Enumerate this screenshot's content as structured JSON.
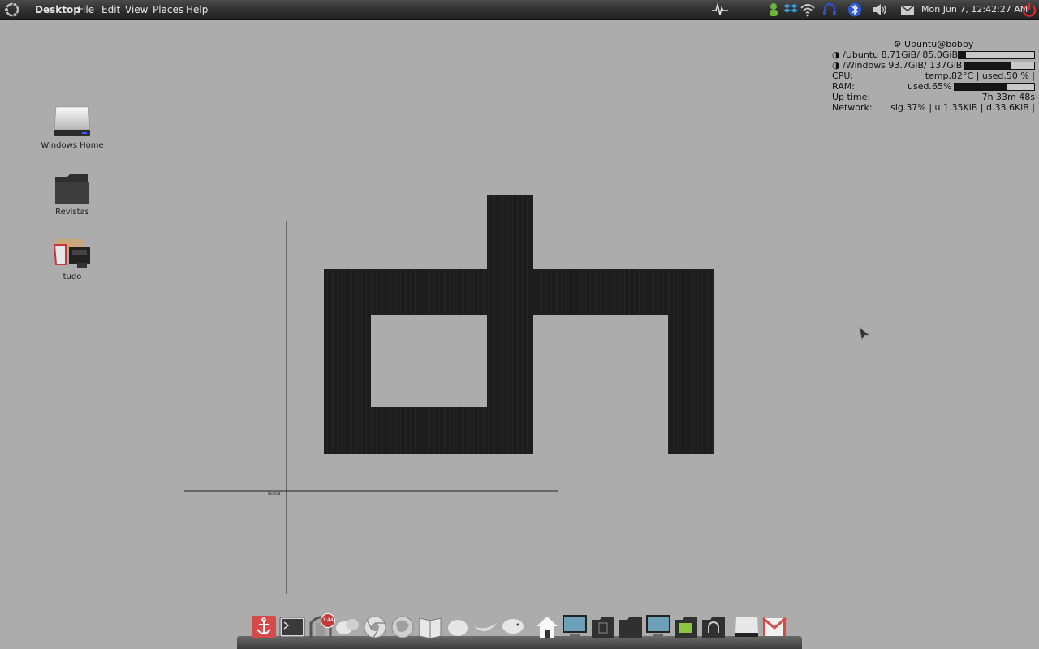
{
  "panel": {
    "app_title": "Desktop",
    "menus": [
      "File",
      "Edit",
      "View",
      "Places",
      "Help"
    ],
    "clock": "Mon Jun  7, 12:42:27 AM"
  },
  "conky": {
    "user": "Ubuntu@bobby",
    "disk_ubuntu": {
      "label": "/Ubuntu 8.71GiB/ 85.0GiB",
      "fraction": 0.1
    },
    "disk_windows": {
      "label": "/Windows 93.7GiB/ 137GiB",
      "fraction": 0.68
    },
    "cpu": {
      "label": "CPU:",
      "value": "temp.82°C | used.50 % |"
    },
    "ram": {
      "label": "RAM:",
      "value": "used.65%",
      "fraction": 0.65
    },
    "uptime": {
      "label": "Up time:",
      "value": "7h 33m 48s"
    },
    "network": {
      "label": "Network:",
      "value": "sig.37% | u.1.35KiB | d.33.6KiB |"
    }
  },
  "desktop_icons": [
    {
      "label": "Windows Home",
      "icon": "drive-icon"
    },
    {
      "label": "Revistas",
      "icon": "folder-icon"
    },
    {
      "label": "tudo",
      "icon": "tool-box-icon"
    }
  ],
  "wallpaper": {
    "brand_caption": "DESIGN"
  },
  "dock": {
    "badge_count": "1:44",
    "items": [
      "anchor-icon",
      "terminal-icon",
      "clock-icon",
      "chat-icon",
      "chrome-icon",
      "firefox-icon",
      "book-icon",
      "pidgin-icon",
      "ribbon-icon",
      "bird-icon",
      "home-icon",
      "monitor-icon",
      "documents-folder-icon",
      "folder-icon",
      "monitor-icon",
      "image-folder-icon",
      "music-folder-icon",
      "drive-icon",
      "gmail-icon"
    ]
  },
  "colors": {
    "accent": "#c23a3a",
    "panel": "#2e2e2e",
    "desktop": "#acacac"
  }
}
